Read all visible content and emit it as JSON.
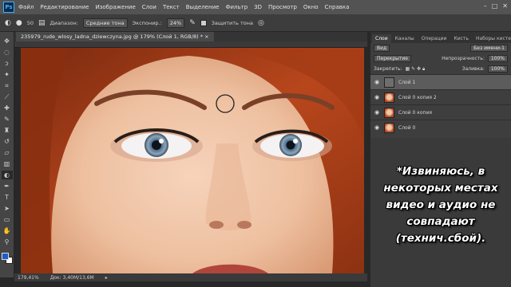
{
  "app": {
    "logo": "Ps"
  },
  "menu": {
    "items": [
      "Файл",
      "Редактирование",
      "Изображение",
      "Слои",
      "Текст",
      "Выделение",
      "Фильтр",
      "3D",
      "Просмотр",
      "Окно",
      "Справка"
    ]
  },
  "window_controls": {
    "minimize": "–",
    "maximize": "□",
    "close": "✕"
  },
  "options": {
    "brush_size": "50",
    "range_label": "Диапазон:",
    "range_value": "Средние тона",
    "exposure_label": "Экспонир.:",
    "exposure_value": "24%",
    "protect_label": "Защитить тона",
    "protect_checked": true
  },
  "document": {
    "tab_title": "235979_rude_wlosy_ladna_dziewczyna.jpg @ 179% (Слой 1, RGB/8) *",
    "close": "×"
  },
  "status": {
    "zoom": "179,41%",
    "doc_size": "Док: 3,40M/13,6M"
  },
  "panel": {
    "tabs": [
      "Слои",
      "Каналы",
      "Операции",
      "Кисть",
      "Наборы кистей"
    ],
    "workspace": "Без имени-1",
    "filter_label": "Вид",
    "blend_mode": "Перекрытие",
    "opacity_label": "Непрозрачность:",
    "opacity_value": "100%",
    "lock_label": "Закрепить:",
    "fill_label": "Заливка:",
    "fill_value": "100%",
    "layers": [
      {
        "name": "Слой 1",
        "thumb": "gray",
        "selected": true
      },
      {
        "name": "Слой 0 копия 2",
        "thumb": "face",
        "selected": false
      },
      {
        "name": "Слой 0 копия",
        "thumb": "face",
        "selected": false
      },
      {
        "name": "Слой 0",
        "thumb": "face",
        "selected": false
      }
    ]
  },
  "caption": {
    "lines": [
      "*Извиняюсь, в",
      "некоторых местах",
      "видео и аудио не",
      "совпадают",
      "(технич.сбой)."
    ]
  },
  "colors": {
    "foreground": "#1e5cc7",
    "background": "#ffffff",
    "ps_accent": "#3fb0ff"
  },
  "tools": [
    "move-icon",
    "marquee-icon",
    "lasso-icon",
    "quick-select-icon",
    "crop-icon",
    "eyedropper-icon",
    "healing-icon",
    "brush-icon",
    "stamp-icon",
    "history-brush-icon",
    "eraser-icon",
    "gradient-icon",
    "dodge-icon",
    "pen-icon",
    "type-icon",
    "path-select-icon",
    "shape-icon",
    "hand-icon",
    "zoom-icon"
  ]
}
